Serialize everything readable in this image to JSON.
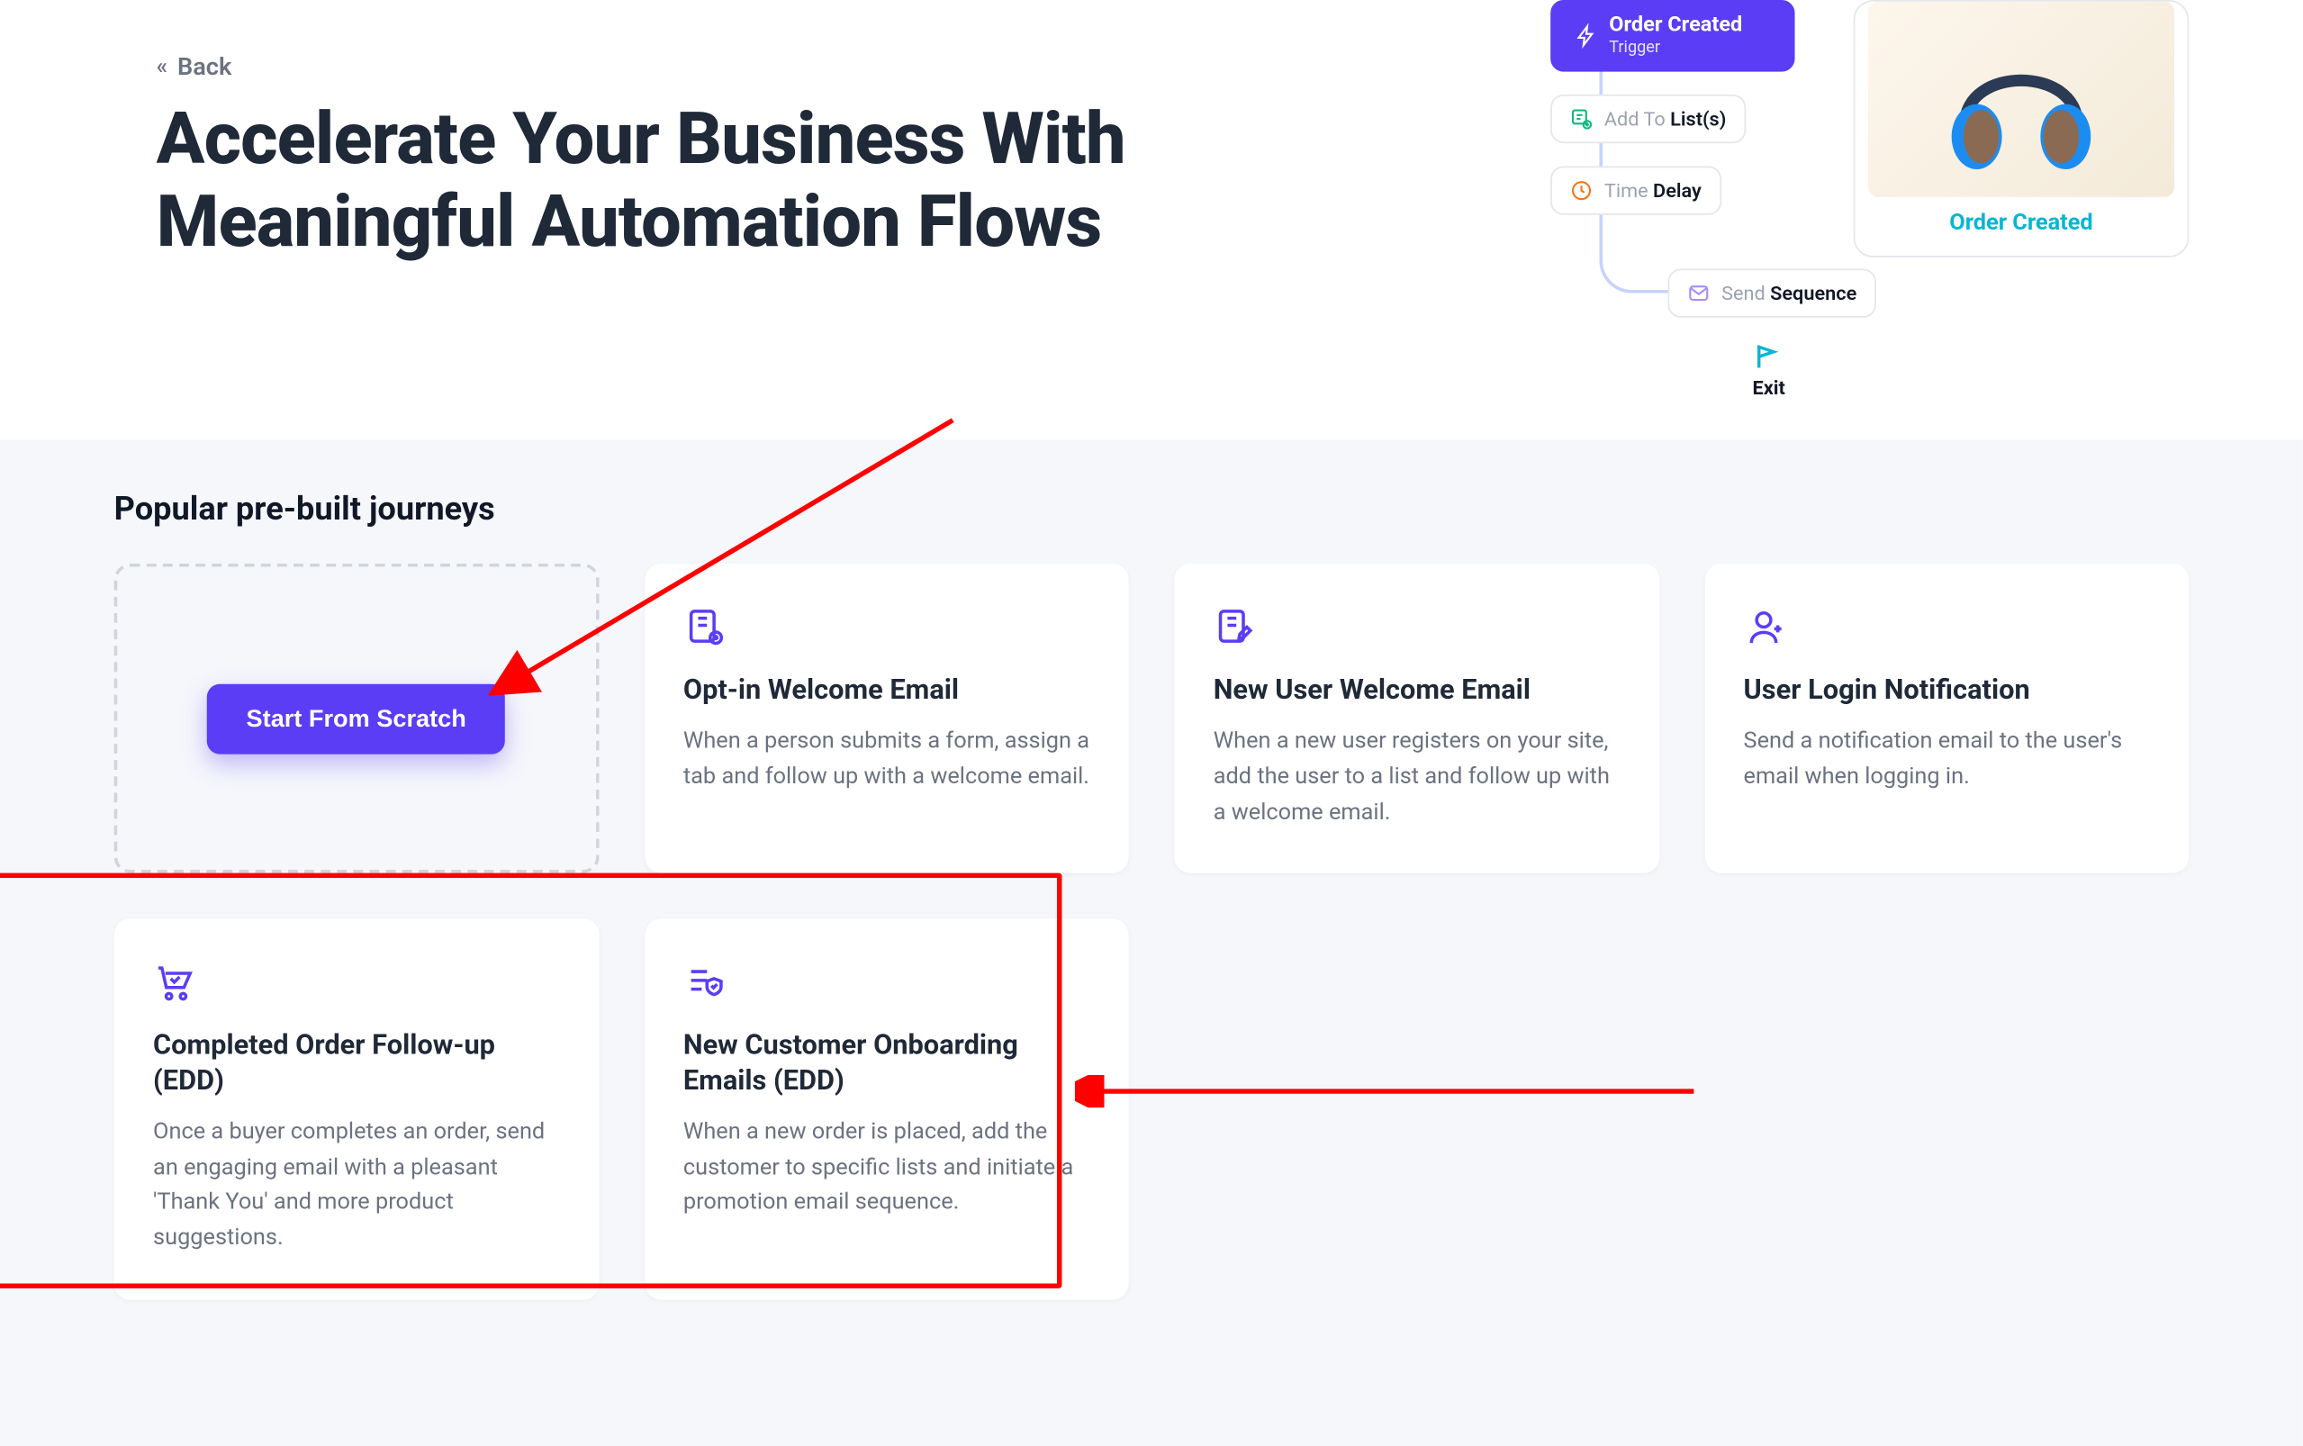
{
  "hero": {
    "back_label": "Back",
    "title": "Accelerate Your Business With Meaningful Automation Flows"
  },
  "flow": {
    "trigger": {
      "label": "Order Created",
      "sub": "Trigger"
    },
    "add_list": {
      "prefix": "Add To ",
      "bold": "List(s)"
    },
    "delay": {
      "prefix": "Time ",
      "bold": "Delay"
    },
    "sequence": {
      "prefix": "Send ",
      "bold": "Sequence"
    },
    "exit": "Exit"
  },
  "product": {
    "label": "Order Created"
  },
  "journeys": {
    "heading": "Popular pre-built journeys",
    "scratch_label": "Start From Scratch",
    "cards": [
      {
        "title": "Opt-in Welcome Email",
        "desc": "When a person submits a form, assign a tab and follow up with a welcome email."
      },
      {
        "title": "New User Welcome Email",
        "desc": "When a new user registers on your site, add the user to a list and follow up with a welcome email."
      },
      {
        "title": "User Login Notification",
        "desc": "Send a notification email to the user's email when logging in."
      },
      {
        "title": "Completed Order Follow-up (EDD)",
        "desc": "Once a buyer completes an order, send an engaging email with a pleasant 'Thank You' and more product suggestions."
      },
      {
        "title": "New Customer Onboarding Emails (EDD)",
        "desc": "When a new order is placed, add the customer to specific lists and initiate a promotion email sequence."
      }
    ]
  }
}
